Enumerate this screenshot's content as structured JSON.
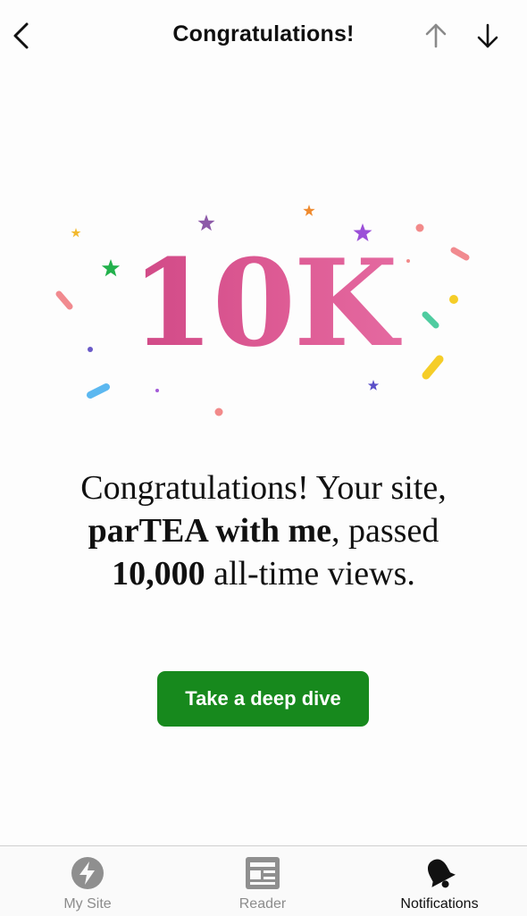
{
  "header": {
    "title": "Congratulations!",
    "back_icon": "chevron-left-icon",
    "prev_icon": "arrow-up-icon",
    "next_icon": "arrow-down-icon"
  },
  "milestone": {
    "headline": "10K",
    "message_part1": "Congratulations! Your site, ",
    "site_name": "parTEA with me",
    "message_part2": ", passed ",
    "views": "10,000",
    "message_part3": " all-time views."
  },
  "cta": {
    "label": "Take a deep dive",
    "color": "#17891d"
  },
  "tabbar": {
    "tabs": [
      {
        "label": "My Site",
        "icon": "wordpress-bolt-icon",
        "active": false
      },
      {
        "label": "Reader",
        "icon": "reader-icon",
        "active": false
      },
      {
        "label": "Notifications",
        "icon": "bell-icon",
        "active": true
      }
    ]
  },
  "colors": {
    "gradient_start": "#c63a7b",
    "gradient_end": "#ec79ad"
  }
}
